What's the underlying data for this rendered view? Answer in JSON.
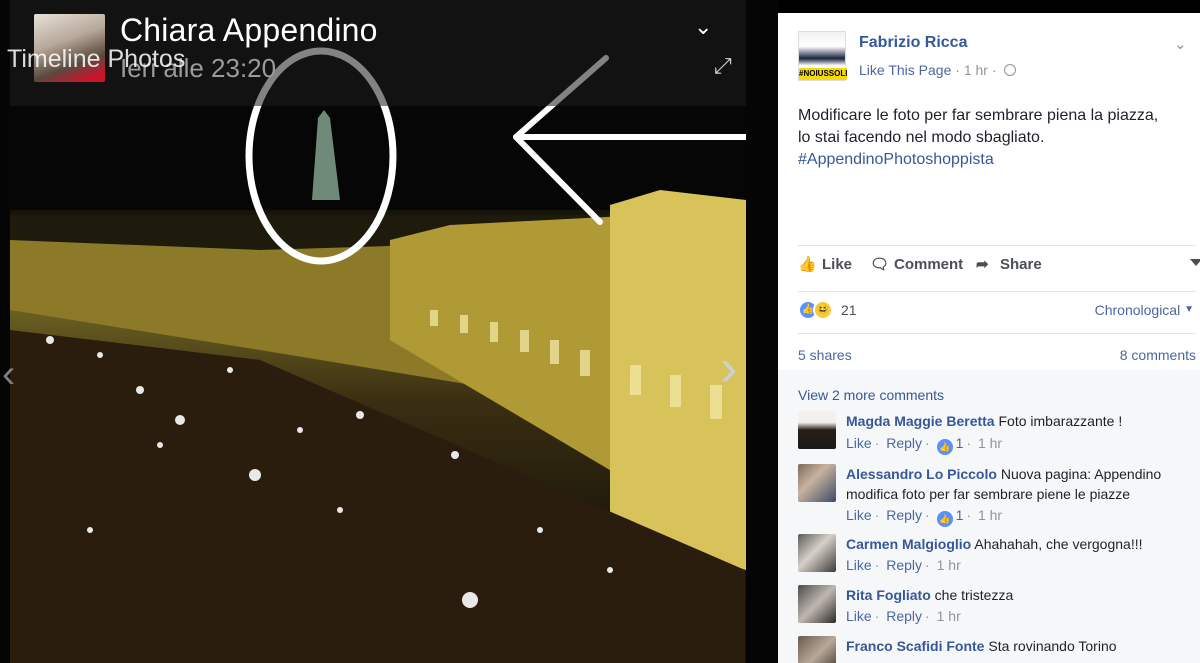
{
  "viewer": {
    "album_label": "Timeline Photos",
    "poster_name": "Chiara Appendino",
    "poster_time": "Ieri alle 23:20"
  },
  "post": {
    "author": "Fabrizio Ricca",
    "avatar_badge": "#NOIUSSOLI",
    "like_page": "Like This Page",
    "time": "1 hr",
    "text_line1": "Modificare le foto per far sembrare piena la piazza,",
    "text_line2": "lo stai facendo nel modo sbagliato.",
    "hashtag": "#AppendinoPhotoshoppista"
  },
  "actions": {
    "like": "Like",
    "comment": "Comment",
    "share": "Share"
  },
  "reactions": {
    "count": "21",
    "order": "Chronological",
    "shares": "5 shares",
    "comments": "8 comments",
    "view_more": "View 2 more comments"
  },
  "comments": [
    {
      "name": "Magda Maggie Beretta",
      "text": "Foto imbarazzante !",
      "like": "Like",
      "reply": "Reply",
      "likes": "1",
      "time": "1 hr"
    },
    {
      "name": "Alessandro Lo Piccolo",
      "text": "Nuova pagina: Appendino modifica foto per far sembrare piene le piazze",
      "like": "Like",
      "reply": "Reply",
      "likes": "1",
      "time": "1 hr"
    },
    {
      "name": "Carmen Malgioglio",
      "text": "Ahahahah, che vergogna!!!",
      "like": "Like",
      "reply": "Reply",
      "time": "1 hr"
    },
    {
      "name": "Rita Fogliato",
      "text": "che tristezza",
      "like": "Like",
      "reply": "Reply",
      "time": "1 hr"
    },
    {
      "name": "Franco Scafidi Fonte",
      "text": "Sta rovinando Torino"
    }
  ]
}
